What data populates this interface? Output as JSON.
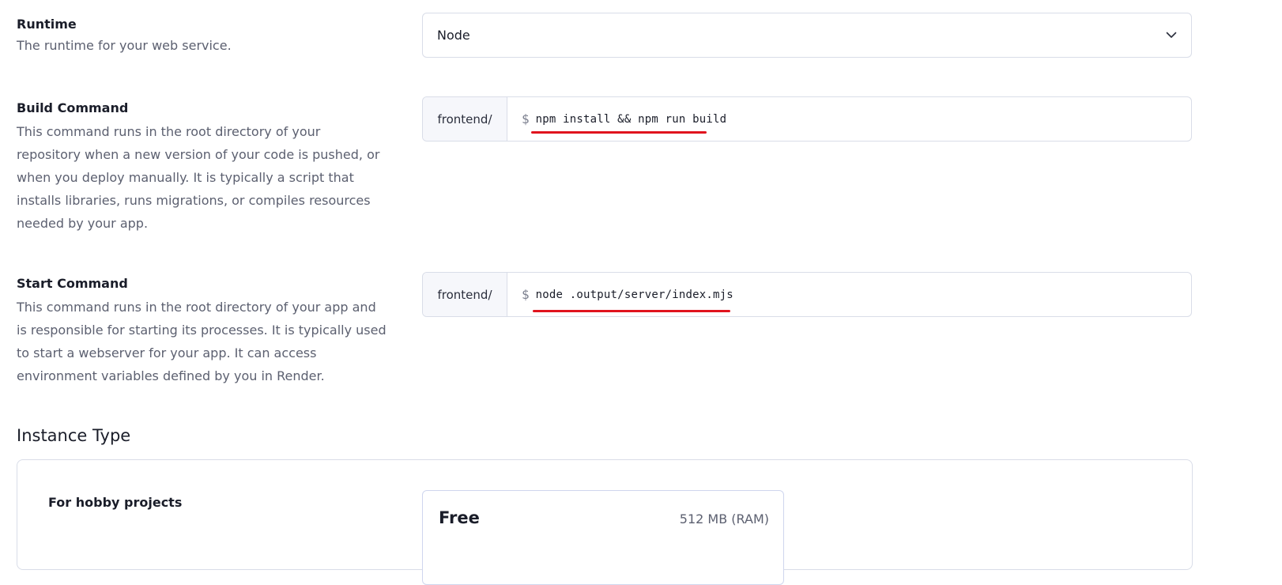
{
  "runtime": {
    "title": "Runtime",
    "description": "The runtime for your web service.",
    "selected": "Node"
  },
  "build_command": {
    "title": "Build Command",
    "description": "This command runs in the root directory of your repository when a new version of your code is pushed, or when you deploy manually. It is typically a script that installs libraries, runs migrations, or compiles resources needed by your app.",
    "prefix": "frontend/",
    "dollar": "$",
    "value": "npm install && npm run build"
  },
  "start_command": {
    "title": "Start Command",
    "description": "This command runs in the root directory of your app and is responsible for starting its processes. It is typically used to start a webserver for your app. It can access environment variables defined by you in Render.",
    "prefix": "frontend/",
    "dollar": "$",
    "value": "node .output/server/index.mjs"
  },
  "instance_type": {
    "heading": "Instance Type",
    "group_label": "For hobby projects",
    "plan": {
      "name": "Free",
      "ram": "512 MB (RAM)"
    }
  },
  "colors": {
    "annotation_underline": "#e0141e",
    "border": "#d9dde8",
    "prefix_background": "#f6f7fb"
  },
  "icons": {
    "runtime_select": "chevron-down-icon"
  }
}
